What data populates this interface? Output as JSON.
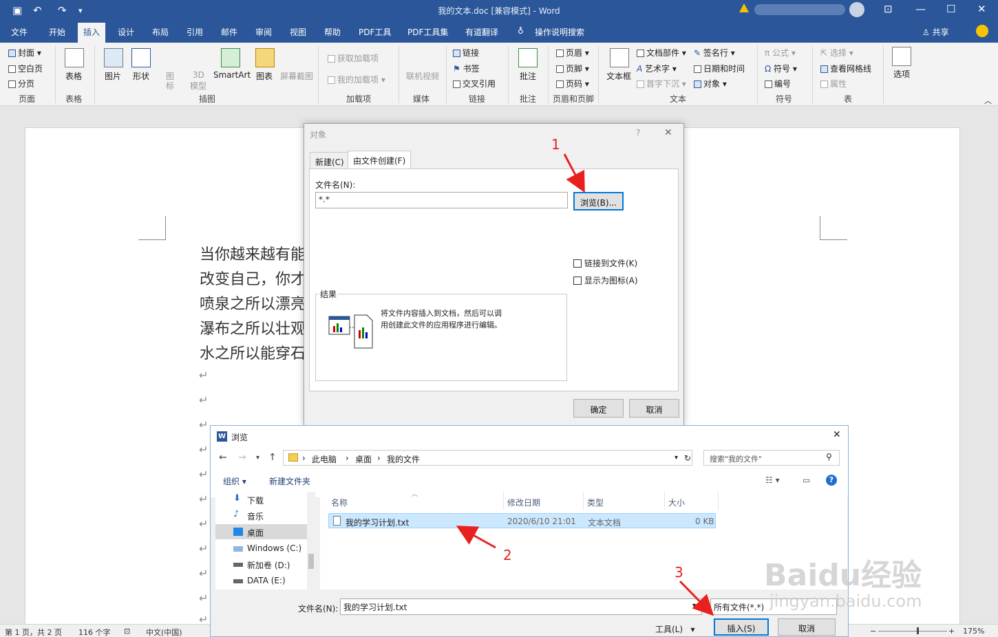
{
  "window": {
    "title": "我的文本.doc [兼容模式] - Word",
    "min": "—",
    "restore": "☐",
    "close": "✕",
    "ribbon_opts": "⊡"
  },
  "tabs": [
    "文件",
    "开始",
    "插入",
    "设计",
    "布局",
    "引用",
    "邮件",
    "审阅",
    "视图",
    "帮助",
    "PDF工具",
    "PDF工具集",
    "有道翻译"
  ],
  "tell_me": "操作说明搜索",
  "share": "共享",
  "ribbon": {
    "page": {
      "cover": "封面",
      "blank": "空白页",
      "break": "分页",
      "group": "页面"
    },
    "table": {
      "label": "表格",
      "group": "表格"
    },
    "illustrations": {
      "picture": "图片",
      "shapes": "形状",
      "icons_1": "图",
      "icons_2": "标",
      "model_1": "3D",
      "model_2": "模型",
      "smartart": "SmartArt",
      "chart": "图表",
      "screenshot": "屏幕截图",
      "group": "插图"
    },
    "addins": {
      "get": "获取加载项",
      "mine": "我的加载项",
      "group": "加载项"
    },
    "media": {
      "video": "联机视频",
      "group": "媒体"
    },
    "links": {
      "link": "链接",
      "bookmark": "书签",
      "xref": "交叉引用",
      "group": "链接"
    },
    "comments": {
      "comment": "批注",
      "group": "批注"
    },
    "header_footer": {
      "header": "页眉",
      "footer": "页脚",
      "pagenum": "页码",
      "group": "页眉和页脚"
    },
    "text": {
      "textbox": "文本框",
      "quickparts": "文档部件",
      "wordart": "艺术字",
      "dropcap": "首字下沉",
      "sigline": "签名行",
      "datetime": "日期和时间",
      "object": "对象",
      "group": "文本"
    },
    "symbols": {
      "equation": "公式",
      "symbol": "符号",
      "number": "编号",
      "group": "符号"
    },
    "table2": {
      "select": "选择",
      "gridlines": "查看网格线",
      "props": "属性",
      "group": "表"
    },
    "options": {
      "label": "选项"
    }
  },
  "document": {
    "lines": [
      "当你越来越有能",
      "改变自己，你才",
      "喷泉之所以漂亮",
      "瀑布之所以壮观",
      "水之所以能穿石"
    ],
    "para_mark": "↵"
  },
  "status": {
    "page": "第 1 页，共 2 页",
    "words": "116 个字",
    "lang": "中文(中国)",
    "zoom": "175%"
  },
  "object_dialog": {
    "title": "对象",
    "help": "?",
    "close": "✕",
    "tab_new": "新建(C)",
    "tab_file": "由文件创建(F)",
    "filename_label": "文件名(N):",
    "filename_value": "*.*",
    "browse": "浏览(B)...",
    "link_file": "链接到文件(K)",
    "show_icon": "显示为图标(A)",
    "result_label": "结果",
    "result_text_1": "将文件内容插入到文档，然后可以调",
    "result_text_2": "用创建此文件的应用程序进行编辑。",
    "ok": "确定",
    "cancel": "取消"
  },
  "browse_dialog": {
    "title": "浏览",
    "close": "✕",
    "path": [
      "此电脑",
      "桌面",
      "我的文件"
    ],
    "search_placeholder": "搜索\"我的文件\"",
    "organize": "组织 ▾",
    "new_folder": "新建文件夹",
    "nav": [
      {
        "label": "下载",
        "icon": "download-icon",
        "selected": false
      },
      {
        "label": "音乐",
        "icon": "music-icon",
        "selected": false
      },
      {
        "label": "桌面",
        "icon": "desktop-icon",
        "selected": true
      },
      {
        "label": "Windows (C:)",
        "icon": "drive-icon",
        "selected": false
      },
      {
        "label": "新加卷 (D:)",
        "icon": "drive-icon",
        "selected": false
      },
      {
        "label": "DATA (E:)",
        "icon": "drive-icon",
        "selected": false
      }
    ],
    "columns": [
      "名称",
      "修改日期",
      "类型",
      "大小"
    ],
    "files": [
      {
        "name": "我的学习计划.txt",
        "modified": "2020/6/10 21:01",
        "type": "文本文档",
        "size": "0 KB"
      }
    ],
    "filename_label": "文件名(N):",
    "filename_value": "我的学习计划.txt",
    "filter": "所有文件(*.*)",
    "tools": "工具(L)",
    "insert": "插入(S)",
    "cancel": "取消"
  },
  "annotations": [
    "1",
    "2",
    "3"
  ],
  "watermark": {
    "main": "Baidu经验",
    "sub": "jingyan.baidu.com"
  },
  "colors": {
    "word_blue": "#2b579a",
    "annotation_red": "#e8201e",
    "selection": "#cce8ff",
    "focus": "#0078d7"
  }
}
